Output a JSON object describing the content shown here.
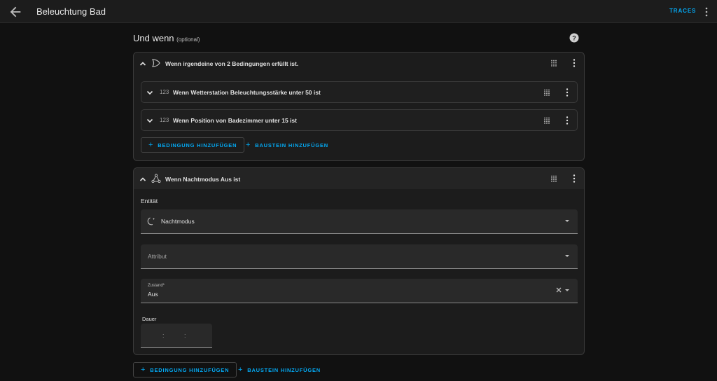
{
  "header": {
    "title": "Beleuchtung Bad",
    "traces_label": "TRACES",
    "back_icon": "arrow-left-icon",
    "menu_icon": "dots-vertical-icon"
  },
  "section": {
    "title": "Und wenn",
    "optional": "(optional)",
    "help_icon": "help-circle-icon"
  },
  "or_card": {
    "label": "Wenn irgendeine von 2 Bedingungen erfüllt ist.",
    "icon": "gate-or-icon",
    "conditions": [
      {
        "label": "Wenn Wetterstation Beleuchtungsstärke unter 50 ist",
        "icon_text": "123"
      },
      {
        "label": "Wenn Position von Badezimmer unter 15 ist",
        "icon_text": "123"
      }
    ],
    "add_condition": "BEDINGUNG HINZUFÜGEN",
    "add_block": "BAUSTEIN HINZUFÜGEN"
  },
  "state_card": {
    "label": "Wenn Nachtmodus Aus ist",
    "icon": "state-machine-icon",
    "entity_label": "Entität",
    "entity_value": "Nachtmodus",
    "entity_icon": "weather-night-icon",
    "attribute_placeholder": "Attribut",
    "state_label": "Zustand*",
    "state_value": "Aus",
    "duration_label": "Dauer",
    "duration_sep": ":"
  },
  "footer": {
    "add_condition": "BEDINGUNG HINZUFÜGEN",
    "add_block": "BAUSTEIN HINZUFÜGEN"
  },
  "colors": {
    "accent": "#03a9f4",
    "background": "#111111",
    "card": "#1c1c1c",
    "field": "#292929"
  }
}
